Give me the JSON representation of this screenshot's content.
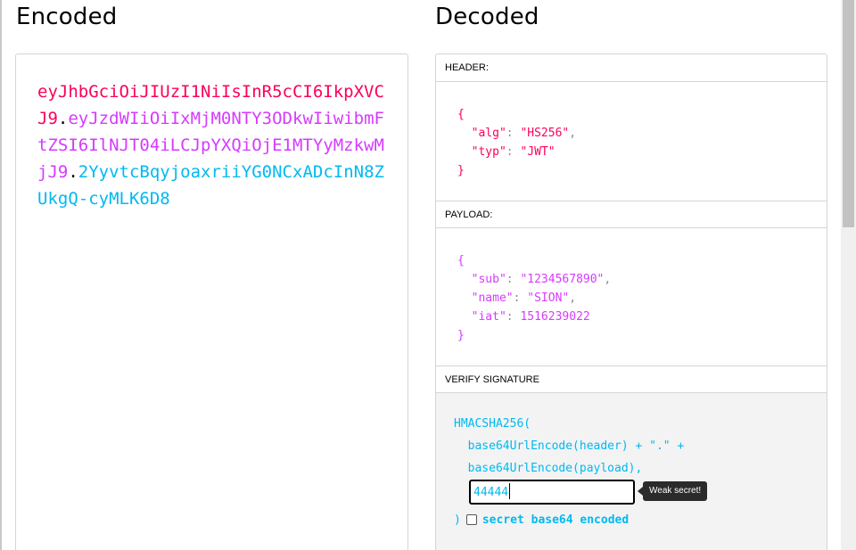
{
  "headings": {
    "encoded": "Encoded",
    "decoded": "Decoded"
  },
  "token": {
    "header": "eyJhbGciOiJIUzI1NiIsInR5cCI6IkpXVCJ9",
    "payload": "eyJzdWIiOiIxMjM0NTY3ODkwIiwibmFtZSI6IlNJT04iLCJpYXQiOjE1MTYyMzkwMjJ9",
    "signature": "2YyvtcBqyjoaxriiYG0NCxADcInN8ZUkgQ-cyMLK6D8",
    "dot": "."
  },
  "sections": {
    "header_label": "HEADER:",
    "payload_label": "PAYLOAD:",
    "verify_label": "VERIFY SIGNATURE"
  },
  "header_json": {
    "open": "{",
    "close": "}",
    "alg_key": "\"alg\"",
    "alg_value": "\"HS256\"",
    "typ_key": "\"typ\"",
    "typ_value": "\"JWT\""
  },
  "payload_json": {
    "open": "{",
    "close": "}",
    "sub_key": "\"sub\"",
    "sub_value": "\"1234567890\"",
    "name_key": "\"name\"",
    "name_value": "\"SION\"",
    "iat_key": "\"iat\"",
    "iat_value": "1516239022"
  },
  "verify": {
    "line1": "HMACSHA256(",
    "line2": "  base64UrlEncode(header) + \".\" +",
    "line3": "  base64UrlEncode(payload),",
    "secret_value": "44444",
    "tooltip": "Weak secret!",
    "close_paren": ")",
    "checkbox_label": "secret base64 encoded"
  },
  "colors": {
    "header": "#fb015b",
    "payload": "#d63aff",
    "signature": "#00b9f1"
  }
}
